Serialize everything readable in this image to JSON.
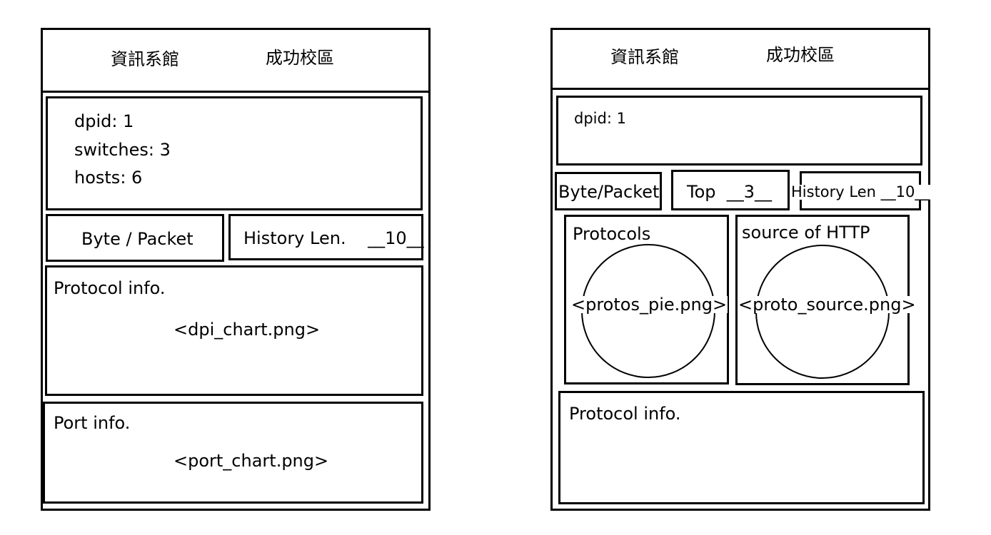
{
  "left": {
    "header": {
      "dept": "資訊系館",
      "campus": "成功校區"
    },
    "info": {
      "dpid": "dpid: 1",
      "switches": "switches: 3",
      "hosts": "hosts: 6"
    },
    "controls": {
      "byte_packet": "Byte / Packet",
      "history_len": "History Len.    __10__"
    },
    "protocol_panel": {
      "title": "Protocol info.",
      "image": "<dpi_chart.png>"
    },
    "port_panel": {
      "title": "Port info.",
      "image": "<port_chart.png>"
    }
  },
  "right": {
    "header": {
      "dept": "資訊系館",
      "campus": "成功校區"
    },
    "info": {
      "dpid": "dpid: 1"
    },
    "controls": {
      "byte_packet": "Byte/Packet",
      "top": "Top  __3__",
      "history_len": "History Len __10__"
    },
    "protocols_panel": {
      "title": "Protocols",
      "image": "<protos_pie.png>"
    },
    "source_panel": {
      "title": "source of HTTP",
      "image": "<proto_source.png>"
    },
    "protocol_panel": {
      "title": "Protocol info."
    }
  }
}
